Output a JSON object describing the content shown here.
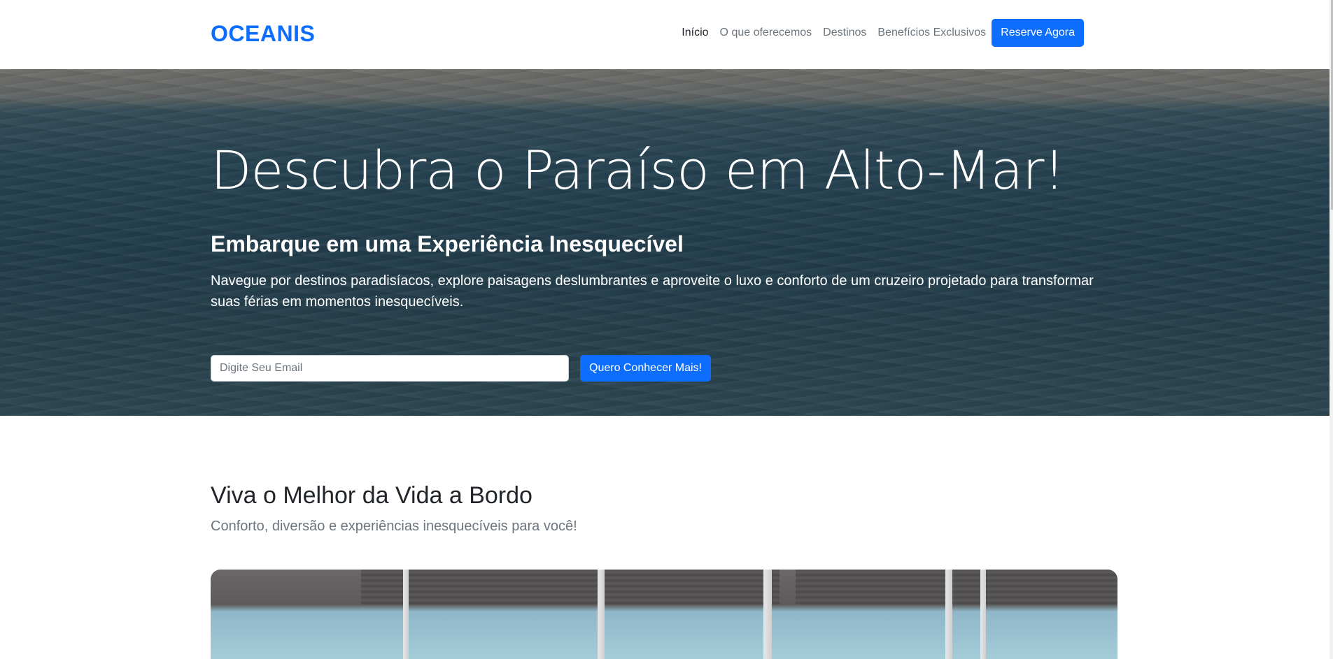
{
  "navbar": {
    "brand": "OCEANIS",
    "links": [
      {
        "label": "Início",
        "active": true
      },
      {
        "label": "O que oferecemos",
        "active": false
      },
      {
        "label": "Destinos",
        "active": false
      },
      {
        "label": "Benefícios Exclusivos",
        "active": false
      }
    ],
    "cta_label": "Reserve Agora"
  },
  "hero": {
    "title": "Descubra o Paraíso em Alto-Mar!",
    "subtitle": "Embarque em uma Experiência Inesquecível",
    "text": "Navegue por destinos paradisíacos, explore paisagens deslumbrantes e aproveite o luxo e conforto de um cruzeiro projetado para transformar suas férias em momentos inesquecíveis.",
    "email_placeholder": "Digite Seu Email",
    "submit_label": "Quero Conhecer Mais!"
  },
  "section": {
    "title": "Viva o Melhor da Vida a Bordo",
    "subtitle": "Conforto, diversão e experiências inesquecíveis para você!"
  },
  "colors": {
    "primary": "#0d6efd",
    "text": "#212529",
    "muted": "#6c757d"
  }
}
